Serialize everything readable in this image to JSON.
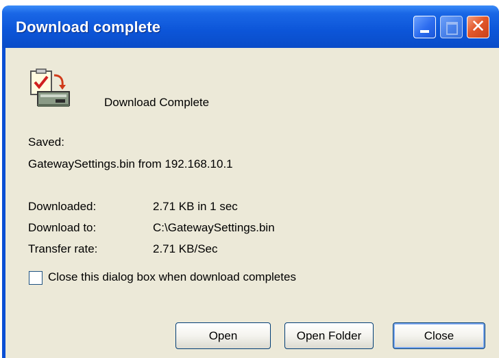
{
  "window": {
    "title": "Download complete",
    "title_bar_color": "#0a4fd4",
    "controls": {
      "minimize_icon": "minimize-icon",
      "maximize_icon": "maximize-icon",
      "close_icon": "close-icon",
      "close_glyph": "✕"
    }
  },
  "header": {
    "icon": "download-complete-icon",
    "text": "Download Complete"
  },
  "saved": {
    "label": "Saved:",
    "value": "GatewaySettings.bin from 192.168.10.1"
  },
  "details": [
    {
      "label": "Downloaded:",
      "value": "2.71 KB in 1 sec"
    },
    {
      "label": "Download to:",
      "value": "C:\\GatewaySettings.bin"
    },
    {
      "label": "Transfer rate:",
      "value": "2.71 KB/Sec"
    }
  ],
  "option": {
    "label": "Close this dialog box when download completes",
    "checked": false
  },
  "buttons": {
    "open": "Open",
    "open_folder": "Open Folder",
    "close": "Close"
  }
}
